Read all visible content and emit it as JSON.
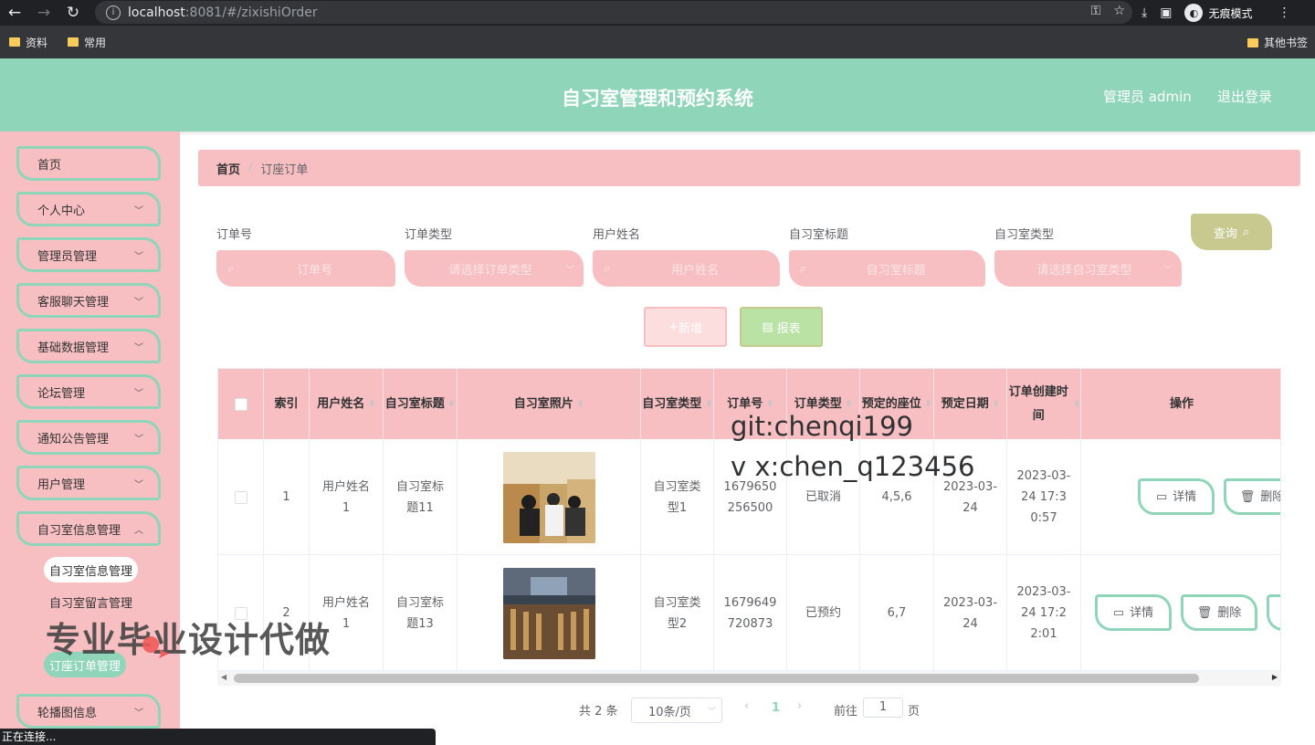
{
  "browser": {
    "url_host": "localhost",
    "url_rest": ":8081/#/zixishiOrder",
    "incognito_label": "无痕模式",
    "bookmarks": [
      "资料",
      "常用"
    ],
    "other_bookmarks": "其他书签",
    "status_text": "正在连接..."
  },
  "header": {
    "title": "自习室管理和预约系统",
    "user": "管理员 admin",
    "logout": "退出登录"
  },
  "sidebar": {
    "items": [
      {
        "label": "首页"
      },
      {
        "label": "个人中心"
      },
      {
        "label": "管理员管理"
      },
      {
        "label": "客服聊天管理"
      },
      {
        "label": "基础数据管理"
      },
      {
        "label": "论坛管理"
      },
      {
        "label": "通知公告管理"
      },
      {
        "label": "用户管理"
      },
      {
        "label": "自习室信息管理"
      },
      {
        "label": "轮播图信息"
      }
    ],
    "subitems": [
      "自习室信息管理",
      "自习室留言管理",
      "订座订单管理"
    ]
  },
  "breadcrumb": {
    "home": "首页",
    "current": "订座订单"
  },
  "filters": {
    "labels": [
      "订单号",
      "订单类型",
      "用户姓名",
      "自习室标题",
      "自习室类型"
    ],
    "placeholders": [
      "订单号",
      "请选择订单类型",
      "用户姓名",
      "自习室标题",
      "请选择自习室类型"
    ],
    "query_button": "查询"
  },
  "actions": {
    "add": "新增",
    "report": "报表"
  },
  "table": {
    "headers": [
      "索引",
      "用户姓名",
      "自习室标题",
      "自习室照片",
      "自习室类型",
      "订单号",
      "订单类型",
      "预定的座位",
      "预定日期",
      "订单创建时间",
      "操作"
    ],
    "rows": [
      {
        "index": "1",
        "user": "用户姓名1",
        "title": "自习室标题11",
        "type": "自习室类型1",
        "order_no": "1679650256500",
        "order_type": "已取消",
        "seats": "4,5,6",
        "date": "2023-03-24",
        "created": "2023-03-24 17:30:57"
      },
      {
        "index": "2",
        "user": "用户姓名1",
        "title": "自习室标题13",
        "type": "自习室类型2",
        "order_no": "1679649720873",
        "order_type": "已预约",
        "seats": "6,7",
        "date": "2023-03-24",
        "created": "2023-03-24 17:22:01"
      }
    ],
    "detail_button": "详情",
    "delete_button": "删除"
  },
  "pagination": {
    "total": "共 2 条",
    "page_size": "10条/页",
    "current": "1",
    "goto": "前往",
    "page_suffix": "页",
    "goto_value": "1"
  },
  "overlays": {
    "watermark1": "git:chenqi199",
    "watermark2": "v x:chen_q123456",
    "promo": "专业毕业设计代做"
  },
  "colors": {
    "accent_green": "#8fd5b9",
    "pink": "#f7bfc1",
    "olive": "#c7c98f"
  }
}
